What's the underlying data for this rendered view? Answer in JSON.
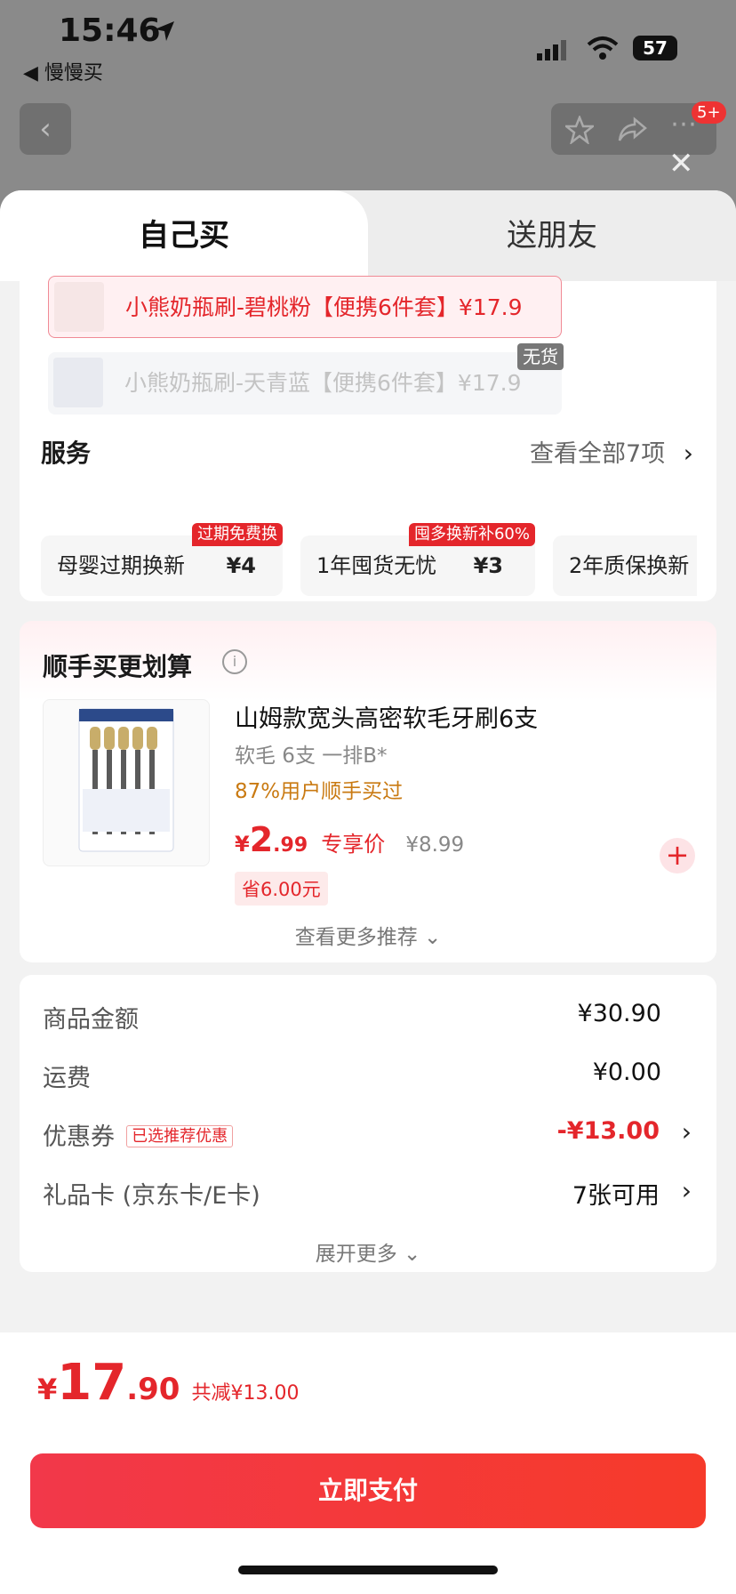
{
  "status_bar": {
    "time": "15:46",
    "back_app": "◀ 慢慢买",
    "battery": "57"
  },
  "top_bar": {
    "badge": "5+"
  },
  "tabs": {
    "self": "自己买",
    "gift": "送朋友"
  },
  "variants": [
    {
      "label": "小熊奶瓶刷-碧桃粉【便携6件套】¥17.9",
      "state": "selected"
    },
    {
      "label": "小熊奶瓶刷-天青蓝【便携6件套】¥17.9",
      "state": "out",
      "tag": "无货"
    }
  ],
  "service": {
    "title": "服务",
    "view_all": "查看全部7项",
    "chips": [
      {
        "name": "母婴过期换新",
        "price": "¥4",
        "tag": "过期免费换"
      },
      {
        "name": "1年囤货无忧",
        "price": "¥3",
        "tag": "囤多换新补60%"
      },
      {
        "name": "2年质保换新",
        "price": "",
        "tag": ""
      }
    ]
  },
  "addon": {
    "title": "顺手买更划算",
    "product_name": "山姆款宽头高密软毛牙刷6支",
    "spec": "软毛 6支 一排B*",
    "social": "87%用户顺手买过",
    "currency": "¥",
    "price_int": "2",
    "price_dec": ".99",
    "price_tag": "专享价",
    "orig_price": "¥8.99",
    "save": "省6.00元",
    "more": "查看更多推荐"
  },
  "summary": {
    "rows": [
      {
        "label": "商品金额",
        "value": "¥30.90"
      },
      {
        "label": "运费",
        "value": "¥0.00"
      },
      {
        "label": "优惠券",
        "tag": "已选推荐优惠",
        "value": "-¥13.00"
      },
      {
        "label": "礼品卡 (京东卡/E卡)",
        "value": "7张可用"
      }
    ],
    "expand": "展开更多"
  },
  "footer": {
    "currency": "¥",
    "total_int": "17",
    "total_dec": ".90",
    "discount": "共减¥13.00",
    "pay_button": "立即支付"
  },
  "colors": {
    "accent": "#e4262b",
    "orange": "#c97a12"
  }
}
